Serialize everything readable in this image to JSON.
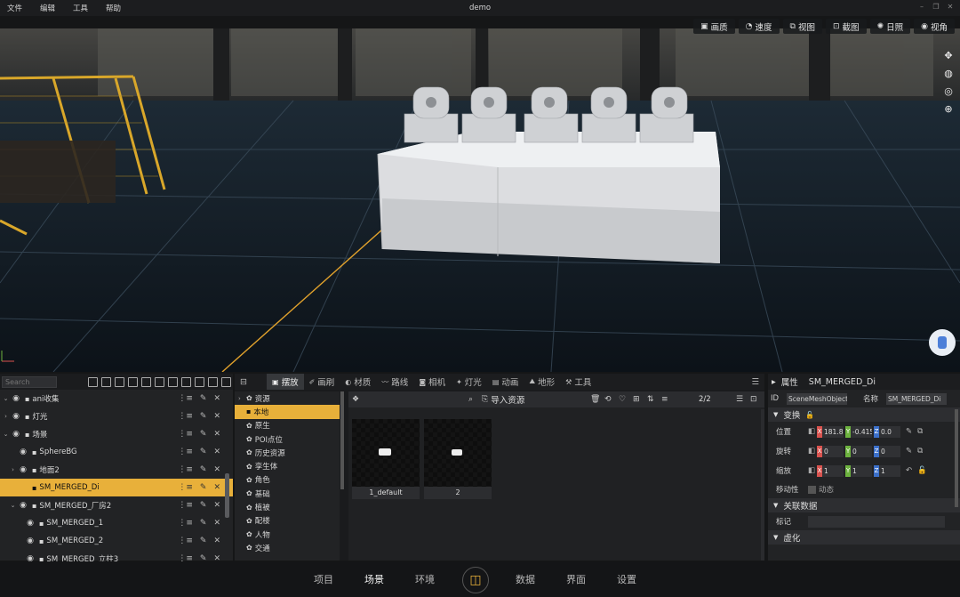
{
  "window": {
    "title": "demo",
    "menus": [
      "文件",
      "编辑",
      "工具",
      "帮助"
    ]
  },
  "viewport_toolbar": [
    {
      "icon": "image-icon",
      "label": "画质"
    },
    {
      "icon": "speed-icon",
      "label": "速度"
    },
    {
      "icon": "view-icon",
      "label": "视图"
    },
    {
      "icon": "screenshot-icon",
      "label": "截图"
    },
    {
      "icon": "sun-icon",
      "label": "日照"
    },
    {
      "icon": "eye-icon",
      "label": "视角"
    }
  ],
  "outliner": {
    "search_placeholder": "Search",
    "rows": [
      {
        "label": "ani收集",
        "expanded": true,
        "indent": 0
      },
      {
        "label": "灯光",
        "expanded": false,
        "indent": 0
      },
      {
        "label": "场景",
        "expanded": true,
        "indent": 0
      },
      {
        "label": "SphereBG",
        "expanded": null,
        "indent": 1
      },
      {
        "label": "地面2",
        "expanded": false,
        "indent": 1
      },
      {
        "label": "SM_MERGED_Di",
        "expanded": null,
        "indent": 1,
        "selected": true
      },
      {
        "label": "SM_MERGED_厂房2",
        "expanded": true,
        "indent": 1
      },
      {
        "label": "SM_MERGED_1",
        "expanded": null,
        "indent": 2
      },
      {
        "label": "SM_MERGED_2",
        "expanded": null,
        "indent": 2
      },
      {
        "label": "SM_MERGED_立柱3",
        "expanded": null,
        "indent": 2
      }
    ]
  },
  "asset_tabs": [
    {
      "label": "摆放",
      "icon": "cube-icon",
      "active": true
    },
    {
      "label": "画刷",
      "icon": "brush-icon"
    },
    {
      "label": "材质",
      "icon": "material-icon"
    },
    {
      "label": "路线",
      "icon": "route-icon"
    },
    {
      "label": "相机",
      "icon": "camera-icon"
    },
    {
      "label": "灯光",
      "icon": "light-icon"
    },
    {
      "label": "动画",
      "icon": "animation-icon"
    },
    {
      "label": "地形",
      "icon": "terrain-icon"
    },
    {
      "label": "工具",
      "icon": "tool-icon"
    }
  ],
  "asset_categories": [
    {
      "label": "资源",
      "expanded": false
    },
    {
      "label": "本地",
      "selected": true
    },
    {
      "label": "原生"
    },
    {
      "label": "POI点位"
    },
    {
      "label": "历史资源"
    },
    {
      "label": "孪生体"
    },
    {
      "label": "角色"
    },
    {
      "label": "基础"
    },
    {
      "label": "植被"
    },
    {
      "label": "配楼"
    },
    {
      "label": "人物"
    },
    {
      "label": "交通"
    }
  ],
  "asset_bar": {
    "import_label": "导入资源",
    "page": "2/2"
  },
  "assets": [
    {
      "name": "1_default"
    },
    {
      "name": "2"
    }
  ],
  "properties": {
    "title": "属性",
    "object_name": "SM_MERGED_Di",
    "id_label": "ID",
    "id_value": "SceneMeshObject",
    "name_label": "名称",
    "name_value": "SM_MERGED_Di",
    "transform_section": "变换",
    "position_label": "位置",
    "position": [
      "181.820",
      "-0.4152",
      "0.0"
    ],
    "rotation_label": "旋转",
    "rotation": [
      "0",
      "0",
      "0"
    ],
    "scale_label": "缩放",
    "scale": [
      "1",
      "1",
      "1"
    ],
    "mobility_label": "移动性",
    "mobility_value": "动态",
    "linked_section": "关联数据",
    "tag_label": "标记",
    "virtual_section": "虚化"
  },
  "bottom_nav": [
    {
      "label": "项目"
    },
    {
      "label": "场景",
      "active": true
    },
    {
      "label": "环境"
    },
    {
      "label": "数据"
    },
    {
      "label": "界面"
    },
    {
      "label": "设置"
    }
  ],
  "colors": {
    "accent": "#e8b03a",
    "axis_x": "#d9534f",
    "axis_y": "#6db33f",
    "axis_z": "#3b6fc9"
  }
}
